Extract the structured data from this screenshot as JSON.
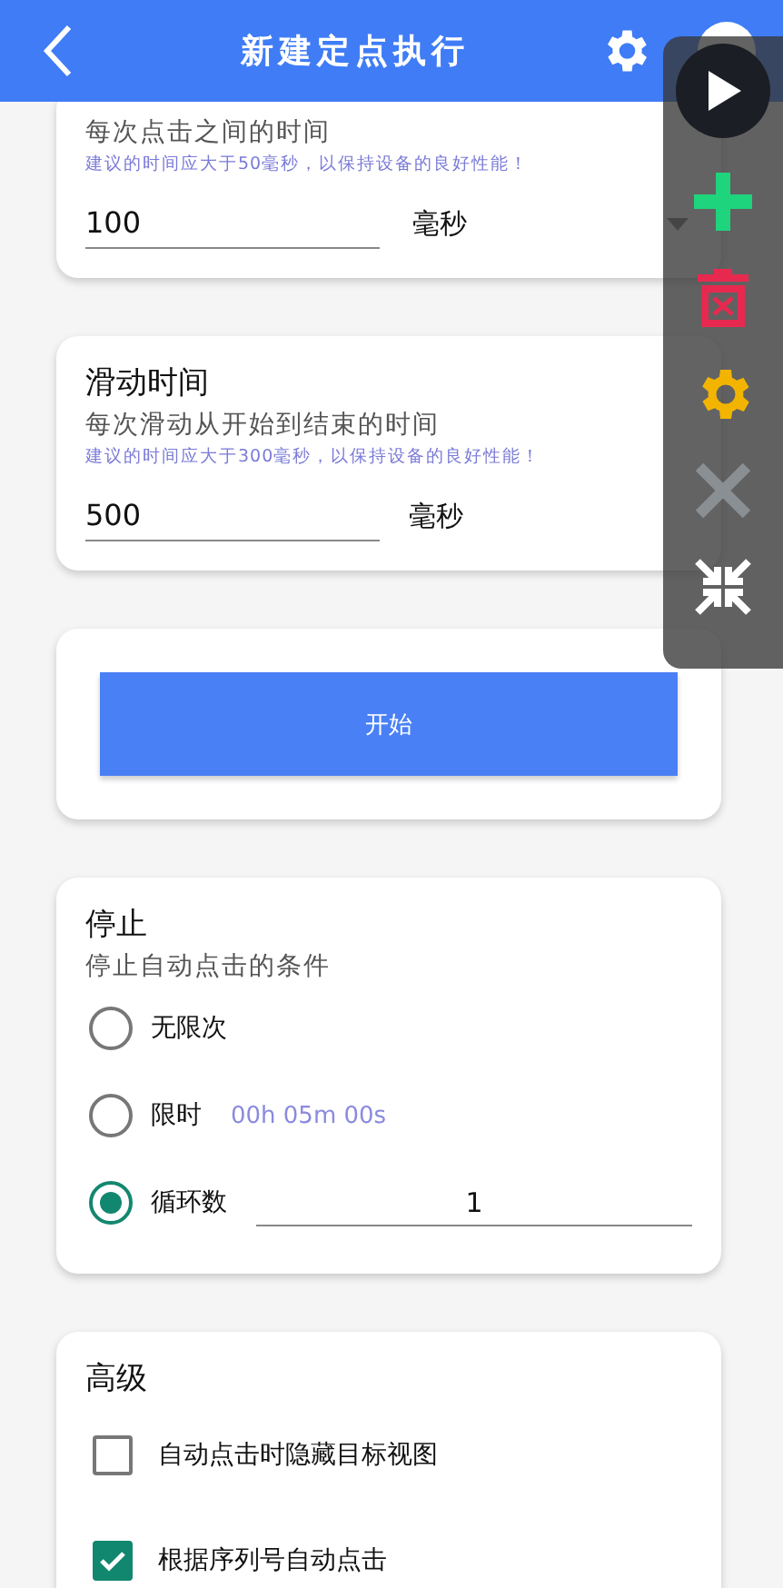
{
  "header": {
    "title": "新建定点执行"
  },
  "interval": {
    "description": "每次点击之间的时间",
    "hint": "建议的时间应大于50毫秒，以保持设备的良好性能！",
    "value": "100",
    "unit": "毫秒"
  },
  "swipe": {
    "title": "滑动时间",
    "description": "每次滑动从开始到结束的时间",
    "hint": "建议的时间应大于300毫秒，以保持设备的良好性能！",
    "value": "500",
    "unit": "毫秒"
  },
  "start_button": "开始",
  "stop": {
    "title": "停止",
    "description": "停止自动点击的条件",
    "options": [
      {
        "kind": "plain",
        "label": "无限次",
        "selected": false
      },
      {
        "kind": "timer",
        "label": "限时",
        "selected": false,
        "detail": "00h 05m 00s"
      },
      {
        "kind": "count",
        "label": "循环数",
        "selected": true,
        "value": "1"
      }
    ]
  },
  "advanced": {
    "title": "高级",
    "options": [
      {
        "label": "自动点击时隐藏目标视图",
        "checked": false
      },
      {
        "label": "根据序列号自动点击",
        "checked": true
      }
    ]
  }
}
